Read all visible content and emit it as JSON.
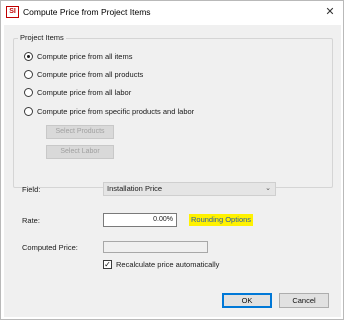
{
  "window": {
    "app_icon_text": "SI",
    "title": "Compute Price from Project Items",
    "close_glyph": "✕"
  },
  "project_items": {
    "group_label": "Project Items",
    "options": [
      {
        "label": "Compute price from all items",
        "checked": true
      },
      {
        "label": "Compute price from all products",
        "checked": false
      },
      {
        "label": "Compute price from all labor",
        "checked": false
      },
      {
        "label": "Compute price from specific products and labor",
        "checked": false
      }
    ],
    "select_products_label": "Select Products",
    "select_labor_label": "Select Labor"
  },
  "field": {
    "label": "Field:",
    "value": "Installation Price",
    "icon": "chevron-down-icon"
  },
  "rate": {
    "label": "Rate:",
    "value": "0.00%",
    "rounding_link": "Rounding Options",
    "highlight_color": "#fff200"
  },
  "computed_price": {
    "label": "Computed Price:",
    "value": ""
  },
  "recalculate": {
    "label": "Recalculate price automatically",
    "checked": true
  },
  "buttons": {
    "ok": "OK",
    "cancel": "Cancel"
  }
}
